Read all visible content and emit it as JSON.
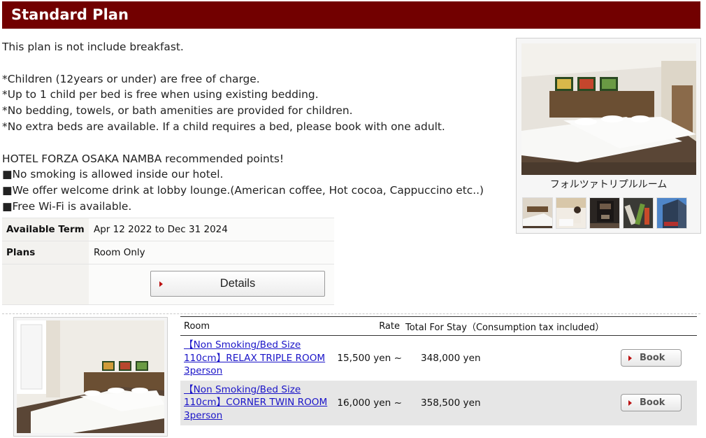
{
  "plan": {
    "title": "Standard Plan",
    "description_lines": [
      "This plan is not include breakfast.",
      "",
      "*Children (12years or under) are free of charge.",
      "*Up to 1 child per bed is free when using existing bedding.",
      "*No bedding, towels, or bath amenities are provided for children.",
      "*No extra beds are available. If a child requires a bed, please book with one adult.",
      "",
      "HOTEL FORZA OSAKA NAMBA recommended points!",
      "■No smoking is allowed inside our hotel.",
      "■We offer welcome drink at lobby lounge.(American coffee, Hot cocoa, Cappuccino etc..)",
      "■Free Wi-Fi is available."
    ],
    "term_label": "Available Term",
    "term_value": "Apr 12 2022 to Dec 31 2024",
    "plans_label": "Plans",
    "plans_value": "Room Only",
    "details_button": "Details"
  },
  "gallery": {
    "caption": "フォルツァトリプルルーム",
    "thumbnails": [
      "room-thumb",
      "lounge-thumb",
      "coffee-machine-thumb",
      "amenities-thumb",
      "exterior-thumb"
    ]
  },
  "rooms_table": {
    "headers": {
      "room": "Room",
      "rate": "Rate",
      "total": "Total For Stay（Consumption tax included）"
    },
    "rows": [
      {
        "name_lines": [
          "【Non Smoking/Bed Size",
          "110cm】RELAX TRIPLE ROOM",
          "3person"
        ],
        "rate": "15,500 yen ~",
        "total": "348,000 yen",
        "book": "Book"
      },
      {
        "name_lines": [
          "【Non Smoking/Bed Size",
          "110cm】CORNER TWIN ROOM",
          "3person"
        ],
        "rate": "16,000 yen ~",
        "total": "358,500 yen",
        "book": "Book"
      }
    ]
  },
  "colors": {
    "header_bg": "#720000",
    "link": "#1a14c8",
    "button_arrow": "#bb1111"
  }
}
